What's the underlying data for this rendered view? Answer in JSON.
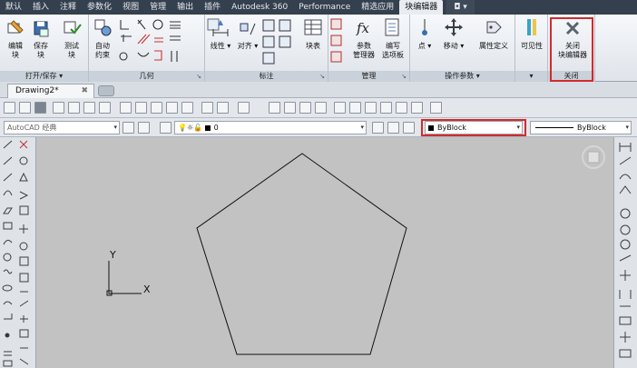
{
  "menu_tabs": [
    "默认",
    "插入",
    "注释",
    "参数化",
    "视图",
    "管理",
    "输出",
    "插件",
    "Autodesk 360",
    "Performance",
    "精选应用",
    "块编辑器"
  ],
  "active_tab": "块编辑器",
  "ribbon": {
    "open_save": {
      "title": "打开/保存",
      "edit_block": "编辑\n块",
      "save_block": "保存\n块",
      "test_block": "测试\n块"
    },
    "geometry": {
      "title": "几何",
      "auto_constrain": "自动\n约束"
    },
    "dimension": {
      "title": "标注",
      "linear": "线性",
      "aligned": "对齐",
      "block_table": "块表"
    },
    "manage": {
      "title": "管理",
      "param_manager": "参数\n管理器",
      "write_palette": "编写\n选项板"
    },
    "action_params": {
      "title": "操作参数",
      "point": "点",
      "move": "移动",
      "attr_def": "属性定义"
    },
    "visibility": {
      "label": "可见性"
    },
    "close": {
      "title": "关闭",
      "close_editor": "关闭\n块编辑器"
    }
  },
  "document": {
    "tab_label": "Drawing2*",
    "close_glyph": "✖"
  },
  "properties": {
    "workspace": "AutoCAD 经典",
    "layer": "0",
    "color": "ByBlock",
    "linetype": "ByBlock"
  },
  "ucs": {
    "x_label": "X",
    "y_label": "Y"
  },
  "colors": {
    "highlight": "#d12b2b",
    "canvas": "#c2c2c2"
  }
}
